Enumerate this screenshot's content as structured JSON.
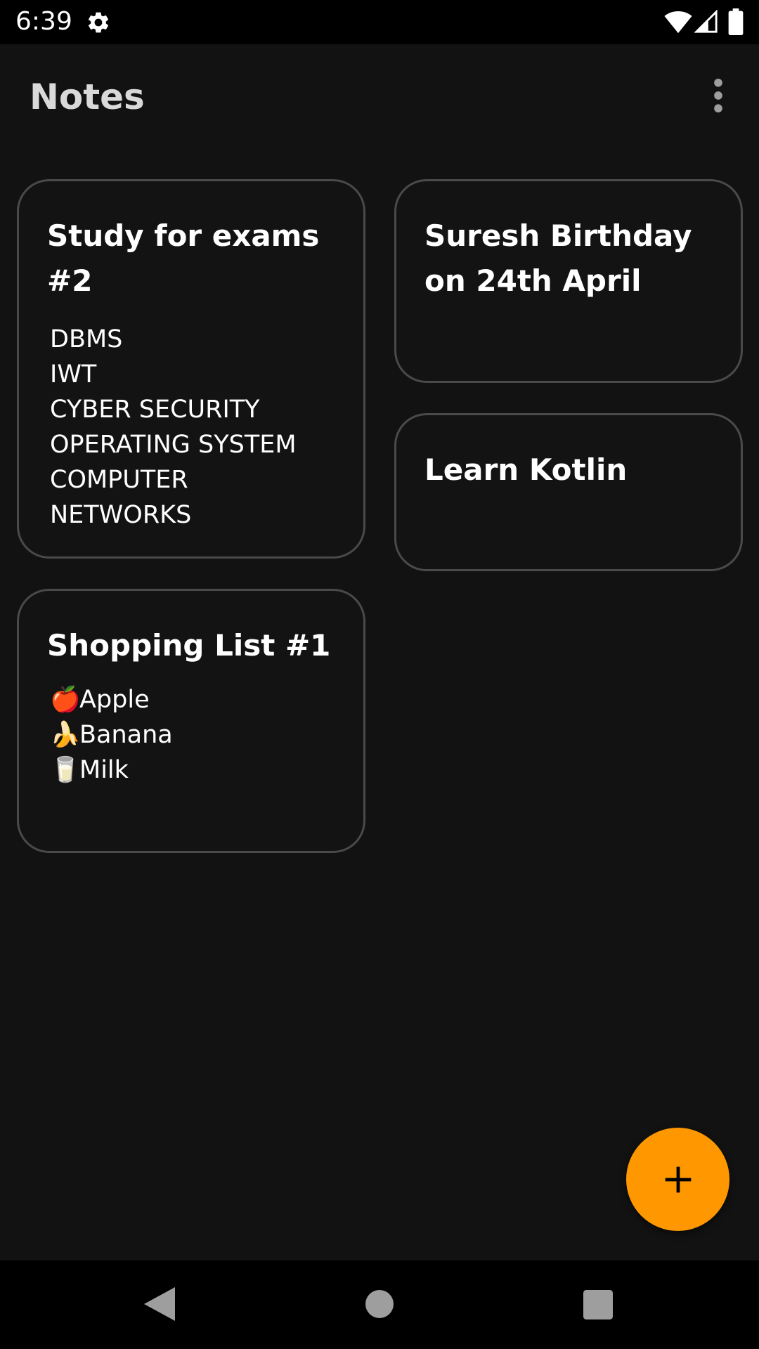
{
  "status_bar": {
    "time": "6:39",
    "icons": [
      "gear-icon",
      "wifi-icon",
      "signal-icon",
      "battery-icon"
    ]
  },
  "app_bar": {
    "title": "Notes",
    "menu_icon": "more-vert-icon"
  },
  "notes": [
    {
      "title": "Study for exams #2",
      "body": [
        "DBMS",
        "IWT",
        "CYBER SECURITY",
        "OPERATING SYSTEM",
        "COMPUTER",
        "NETWORKS"
      ]
    },
    {
      "title": "Suresh Birthday on 24th April",
      "body": []
    },
    {
      "title": "Learn Kotlin",
      "body": []
    },
    {
      "title": "Shopping List #1",
      "body": [
        {
          "emoji": "🍎",
          "text": "Apple"
        },
        {
          "emoji": "🍌",
          "text": "Banana"
        },
        {
          "emoji": "🥛",
          "text": "Milk"
        }
      ]
    }
  ],
  "fab": {
    "icon": "add-icon"
  },
  "nav_bar": {
    "icons": [
      "back-icon",
      "home-icon",
      "recents-icon"
    ]
  },
  "colors": {
    "background": "#121212",
    "card_border": "#4a4a4a",
    "fab": "#ff9800",
    "system_bars": "#000000"
  }
}
